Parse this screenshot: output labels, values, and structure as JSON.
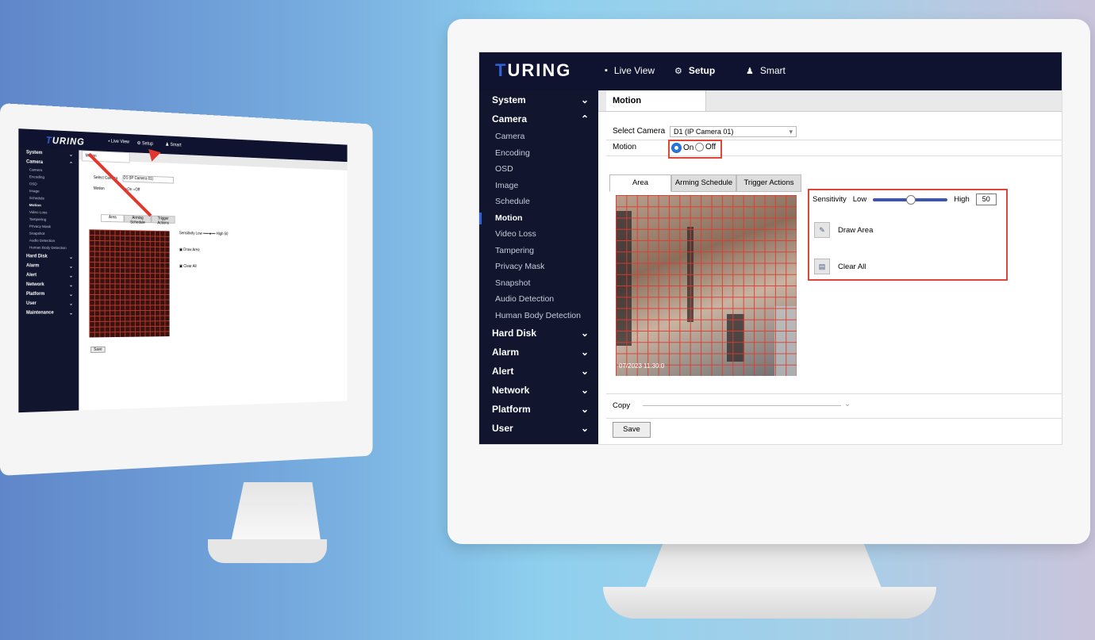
{
  "app": {
    "logo_prefix": "T",
    "logo_rest": "URING"
  },
  "nav": [
    {
      "icon": "monitor-icon",
      "label": "Live View"
    },
    {
      "icon": "gear-icon",
      "label": "Setup"
    },
    {
      "icon": "person-icon",
      "label": "Smart"
    }
  ],
  "sidebar": {
    "system": "System",
    "camera": "Camera",
    "camera_items": [
      "Camera",
      "Encoding",
      "OSD",
      "Image",
      "Schedule",
      "Motion",
      "Video Loss",
      "Tampering",
      "Privacy Mask",
      "Snapshot",
      "Audio Detection",
      "Human Body Detection"
    ],
    "active_item": "Motion",
    "groups_after": [
      "Hard Disk",
      "Alarm",
      "Alert",
      "Network",
      "Platform",
      "User"
    ],
    "small_extra_group": "Maintenance"
  },
  "page": {
    "tab_title": "Motion",
    "select_camera_label": "Select Camera",
    "select_camera_value": "D1 (IP Camera 01)",
    "motion_label": "Motion",
    "motion_on": "On",
    "motion_off": "Off",
    "motion_selected": "On",
    "subtabs": [
      "Area",
      "Arming Schedule",
      "Trigger Actions"
    ],
    "active_subtab": "Area",
    "sensitivity_label": "Sensitivity",
    "sensitivity_low": "Low",
    "sensitivity_high": "High",
    "sensitivity_value": "50",
    "draw_area": "Draw Area",
    "clear_all": "Clear All",
    "copy_label": "Copy",
    "save_label": "Save",
    "camera_timestamp": "07/2023 11:30:0"
  },
  "colors": {
    "topbar": "#0f1330",
    "sidebar": "#12152e",
    "accent": "#2e63d8",
    "highlight_box": "#e0473a",
    "grid": "#e03a30"
  }
}
